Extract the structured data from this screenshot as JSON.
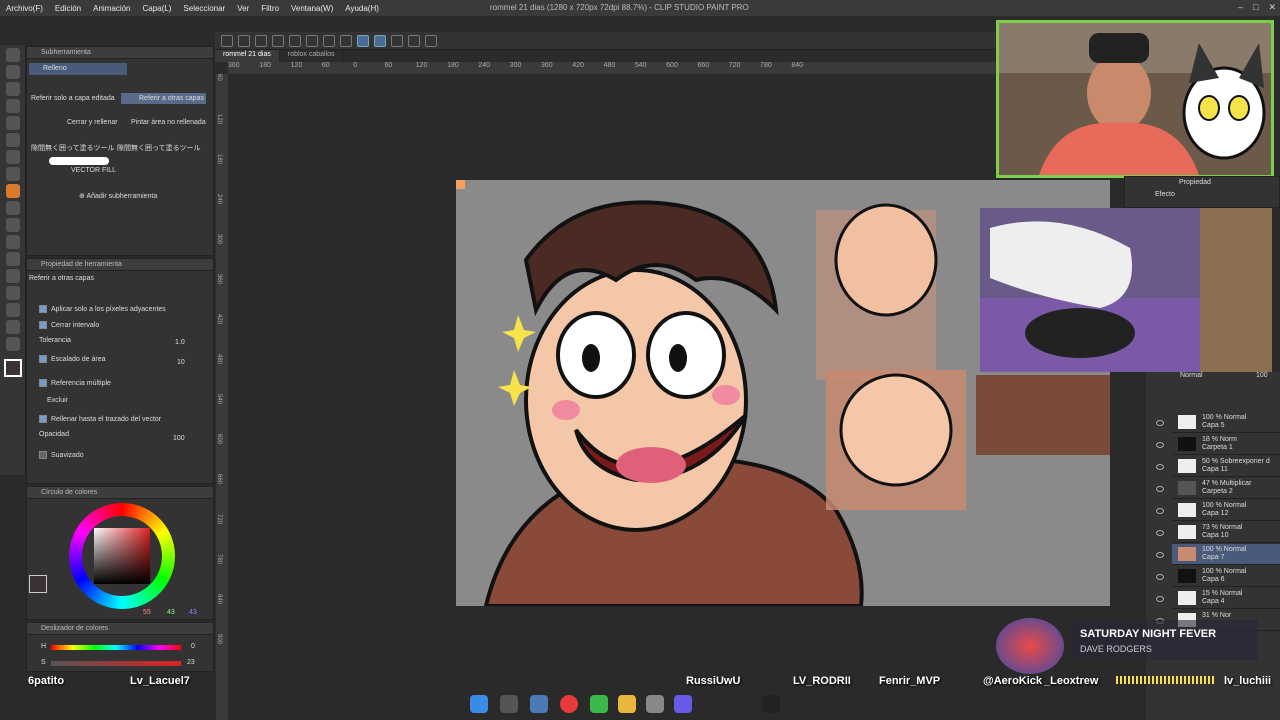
{
  "window": {
    "title": "rommel 21 dias (1280 x 720px 72dpi 88.7%) - CLIP STUDIO PAINT PRO"
  },
  "menu": [
    "Archivo(F)",
    "Edición",
    "Animación",
    "Capa(L)",
    "Seleccionar",
    "Ver",
    "Filtro",
    "Ventana(W)",
    "Ayuda(H)"
  ],
  "subtool_panel": {
    "tab_active": "Subherramienta",
    "tab_other": "Relleno",
    "items": [
      "Referir solo a capa editada",
      "Referir a otras capas",
      "Cerrar y rellenar",
      "Pintar área no rellenada",
      "隙間無く囲って塗るツール",
      "隙間無く囲って塗るツール",
      "VECTOR FILL"
    ],
    "add_label": "Añadir subherramienta"
  },
  "tool_property": {
    "header": "Propiedad de herramienta",
    "subtitle": "Referir a otras capas",
    "rows": {
      "adjacent": "Aplicar solo a los píxeles adyacentes",
      "close_gap": "Cerrar intervalo",
      "tolerance": "Tolerancia",
      "tolerance_val": "1.0",
      "area_scale": "Escalado de área",
      "area_scale_val": "10",
      "multi_ref": "Referencia múltiple",
      "exclude": "Excluir",
      "fill_vector": "Rellenar hasta el trazado del vector",
      "opacity": "Opacidad",
      "opacity_val": "100",
      "smoothing": "Suavizado"
    }
  },
  "color_wheel": {
    "header": "Círculo de colores",
    "values": [
      "55",
      "43",
      "43"
    ]
  },
  "color_slider": {
    "header": "Deslizador de colores",
    "h_label": "H",
    "h_val": "0",
    "s_label": "S",
    "s_val": "23"
  },
  "tabs": [
    "rommel 21 dias",
    "roblox caballos"
  ],
  "ruler_h": [
    "360",
    "180",
    "120",
    "60",
    "0",
    "60",
    "120",
    "180",
    "240",
    "300",
    "360",
    "420",
    "480",
    "540",
    "600",
    "660",
    "720",
    "780",
    "840"
  ],
  "ruler_v": [
    "60",
    "120",
    "180",
    "240",
    "300",
    "360",
    "420",
    "480",
    "540",
    "600",
    "660",
    "720",
    "780",
    "840",
    "900"
  ],
  "properties_panel": {
    "header": "Propiedad",
    "effect": "Efecto"
  },
  "layers": [
    {
      "blend": "100 % Normal",
      "name": "Capa 5"
    },
    {
      "blend": "18 % Norm",
      "name": "Carpeta 1"
    },
    {
      "blend": "50 % Sobreexponer d",
      "name": "Capa 11"
    },
    {
      "blend": "47 % Multiplicar",
      "name": "Carpeta 2"
    },
    {
      "blend": "100 % Normal",
      "name": "Capa 12"
    },
    {
      "blend": "73 % Normal",
      "name": "Capa 10"
    },
    {
      "blend": "100 % Normal",
      "name": "Capa 7"
    },
    {
      "blend": "100 % Normal",
      "name": "Capa 6"
    },
    {
      "blend": "15 % Normal",
      "name": "Capa 4"
    },
    {
      "blend": "31 % Nor",
      "name": ""
    }
  ],
  "layer_header": "Normal",
  "layer_header_val": "100",
  "song": {
    "title": "SATURDAY NIGHT FEVER",
    "artist": "DAVE RODGERS"
  },
  "chat_names": [
    "6patito",
    "Lv_Lacuel7",
    "RussiUwU",
    "LV_RODRII",
    "Fenrir_MVP",
    "@AeroKick",
    "_Leoxtrew",
    "lv_luchiii"
  ],
  "colors": {
    "accent": "#d97a2c",
    "webcam_border": "#7bd04b",
    "canvas_bg": "#8a8a8a"
  }
}
